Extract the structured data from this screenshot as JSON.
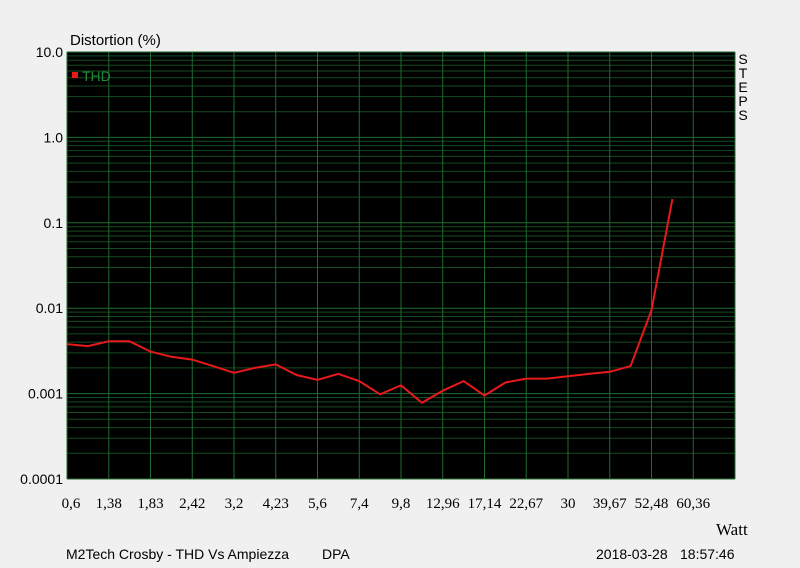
{
  "colors": {
    "background": "#f0f0f0",
    "plot_bg": "#000000",
    "grid": "#1f6b2e",
    "grid_minor": "#164a20",
    "series": "#e8191a",
    "legend_text": "#1e8a3a"
  },
  "footer": {
    "left": "M2Tech Crosby - THD Vs Ampiezza",
    "middle": "DPA",
    "date": "2018-03-28",
    "time": "18:57:46"
  },
  "side_label": [
    "S",
    "T",
    "E",
    "P",
    "S"
  ],
  "chart_data": {
    "type": "line",
    "ylabel": "Distortion (%)",
    "xlabel": "Watt",
    "yscale": "log",
    "ylim": [
      0.0001,
      10
    ],
    "y_ticks": [
      "0.0001",
      "0.001",
      "0.01",
      "0.1",
      "1.0",
      "10.0"
    ],
    "x_ticks": [
      "0,6",
      "1,38",
      "1,83",
      "2,42",
      "3,2",
      "4,23",
      "5,6",
      "7,4",
      "9,8",
      "12,96",
      "17,14",
      "22,67",
      "30",
      "39,67",
      "52,48",
      "60,36"
    ],
    "grid": true,
    "legend_position": "top-left",
    "series": [
      {
        "name": "THD",
        "color": "#e8191a",
        "steps": [
          0,
          0.5,
          1,
          1.5,
          2,
          2.5,
          3,
          3.5,
          4,
          4.5,
          5,
          5.5,
          6,
          6.5,
          7,
          7.5,
          8,
          8.5,
          9,
          9.5,
          10,
          10.5,
          11,
          11.5,
          12,
          12.5,
          13,
          13.5,
          14,
          14.5,
          15,
          15.5,
          16
        ],
        "values": [
          0.0038,
          0.0036,
          0.0041,
          0.0041,
          0.0031,
          0.0027,
          0.0025,
          0.0021,
          0.00175,
          0.002,
          0.0022,
          0.00165,
          0.00145,
          0.0017,
          0.0014,
          0.00098,
          0.00125,
          0.00078,
          0.00108,
          0.0014,
          0.00095,
          0.00135,
          0.0015,
          0.0015,
          0.0016,
          0.0017,
          0.0018,
          0.0021,
          0.0095,
          0.19
        ]
      }
    ]
  }
}
